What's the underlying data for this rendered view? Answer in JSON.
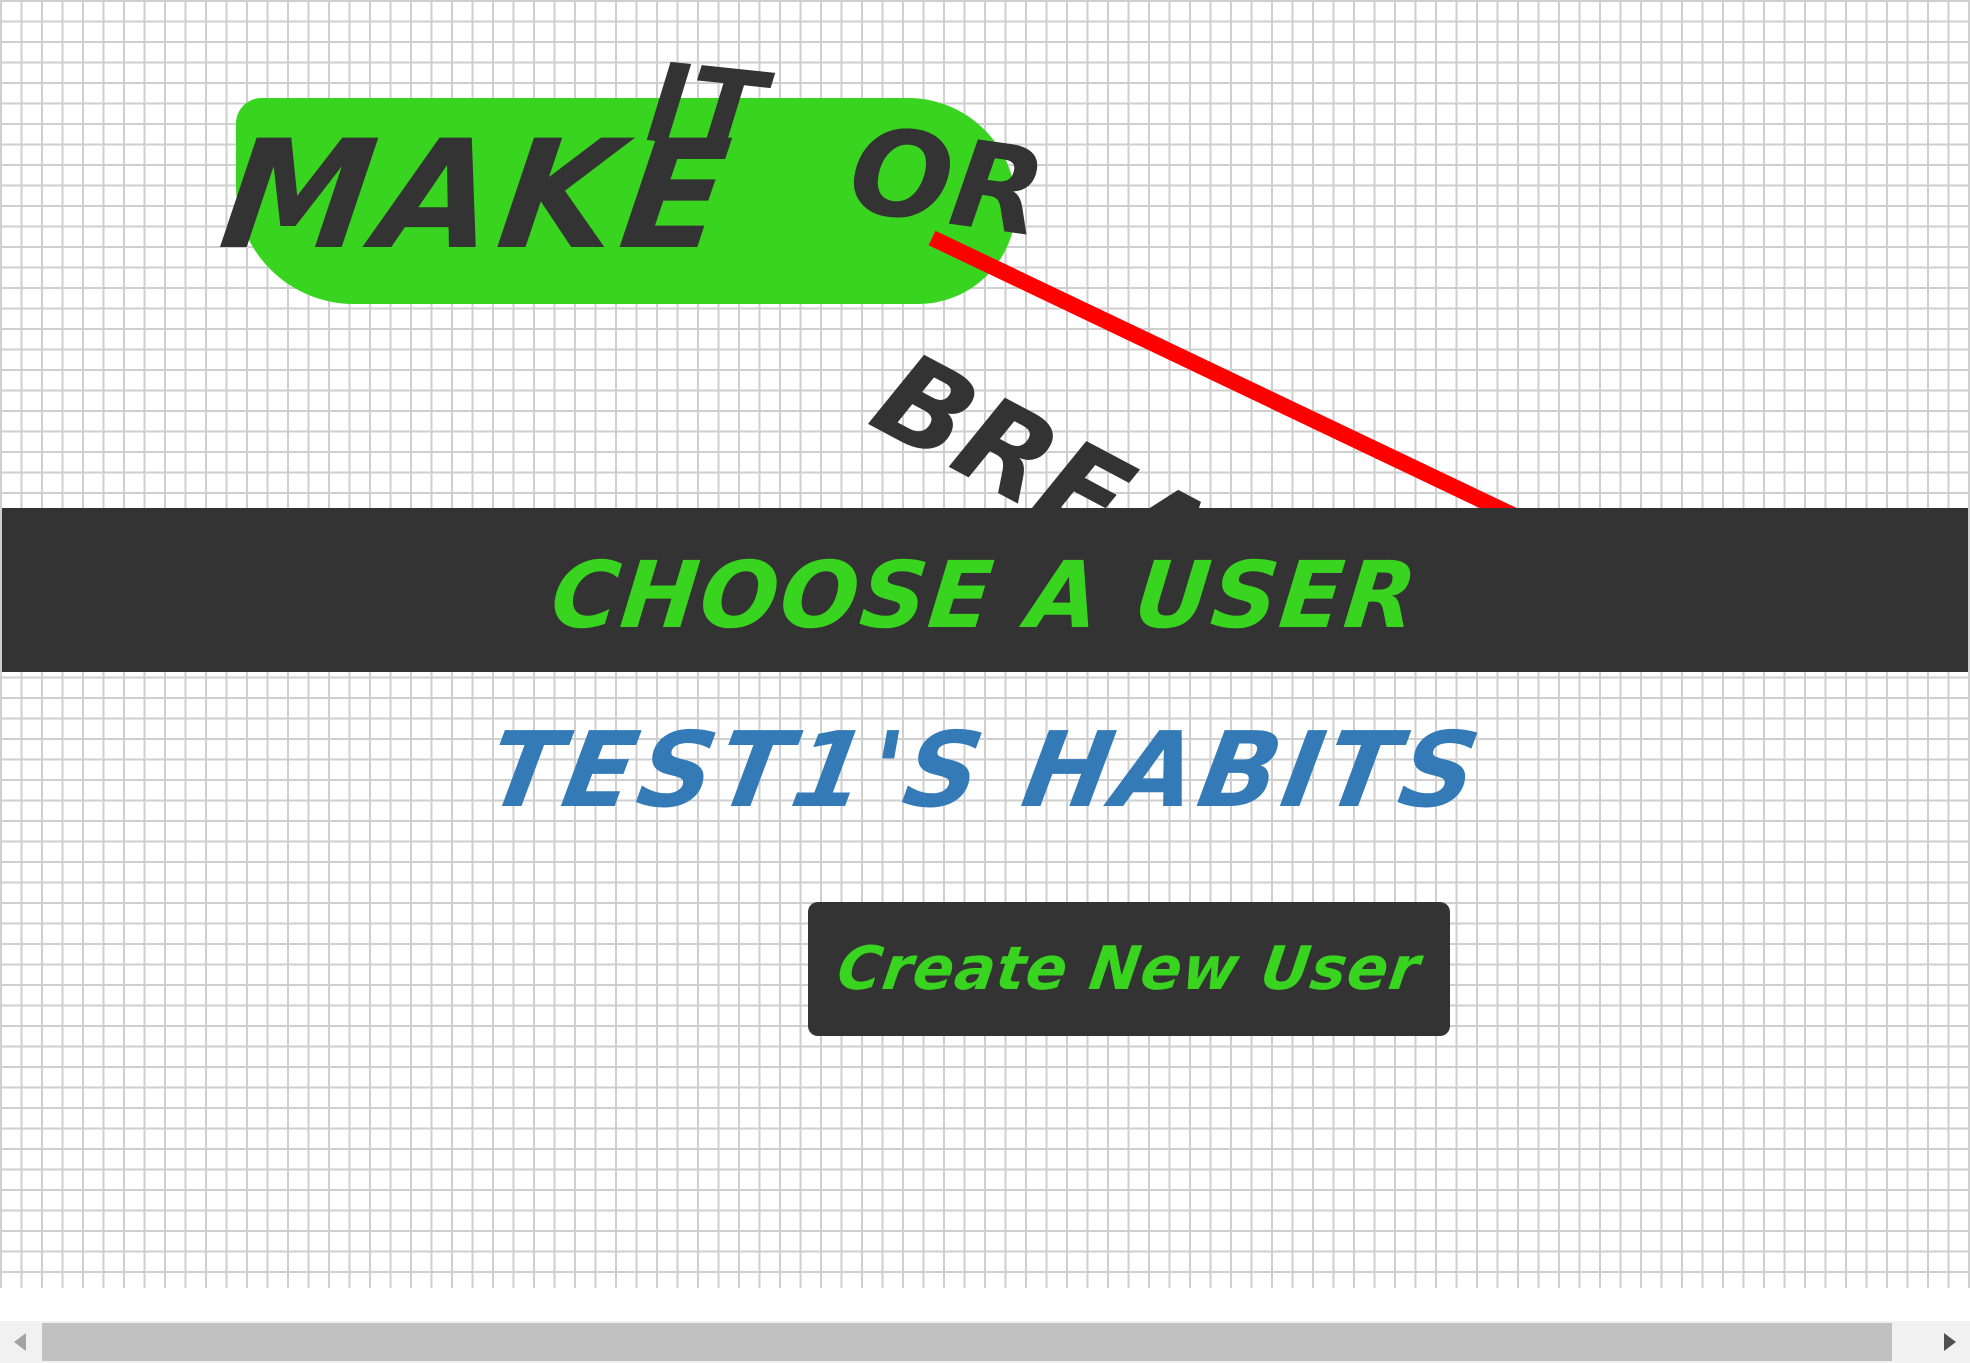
{
  "logo": {
    "make": "MAKE",
    "it": "IT",
    "or": "OR",
    "break": "BREAK"
  },
  "header": {
    "title": "CHOOSE A USER"
  },
  "users": [
    {
      "label": "TEST1'S HABITS"
    }
  ],
  "actions": {
    "create_label": "Create New User"
  },
  "colors": {
    "accent_green": "#39d41f",
    "dark": "#333333",
    "link_blue": "#337ab7",
    "strike_red": "#ff0000"
  }
}
